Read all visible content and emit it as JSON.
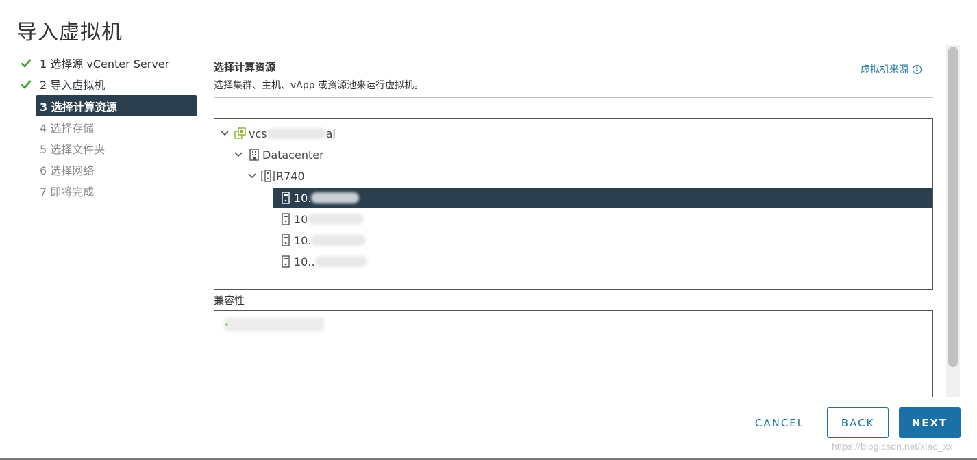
{
  "dialog": {
    "title": "导入虚拟机"
  },
  "steps": [
    {
      "label": "1 选择源 vCenter Server",
      "state": "done"
    },
    {
      "label": "2 导入虚拟机",
      "state": "done"
    },
    {
      "label": "3 选择计算资源",
      "state": "active"
    },
    {
      "label": "4 选择存储",
      "state": "todo"
    },
    {
      "label": "5 选择文件夹",
      "state": "todo"
    },
    {
      "label": "6 选择网络",
      "state": "todo"
    },
    {
      "label": "7 即将完成",
      "state": "todo"
    }
  ],
  "main": {
    "title": "选择计算资源",
    "description": "选择集群、主机、vApp 或资源池来运行虚拟机。",
    "source_link": "虚拟机来源",
    "tree": {
      "vcenter": {
        "prefix": "vcs",
        "suffix": "al",
        "icon": "vcenter-icon"
      },
      "datacenter": {
        "label": "Datacenter",
        "icon": "datacenter-icon"
      },
      "cluster": {
        "label": "R740",
        "icon": "cluster-icon"
      },
      "hosts": [
        {
          "label": "10.",
          "selected": true,
          "icon": "host-icon"
        },
        {
          "label": "10",
          "selected": false,
          "icon": "host-icon"
        },
        {
          "label": "10.",
          "selected": false,
          "icon": "host-icon"
        },
        {
          "label": "10..",
          "selected": false,
          "icon": "host-icon"
        }
      ]
    },
    "compat_label": "兼容性"
  },
  "footer": {
    "cancel": "CANCEL",
    "back": "BACK",
    "next": "NEXT"
  },
  "watermark": "https://blog.csdn.net/xiao_xx",
  "colors": {
    "accent": "#1b70a6",
    "selected_bg": "#2b3f4f",
    "check": "#3c9c2c"
  }
}
